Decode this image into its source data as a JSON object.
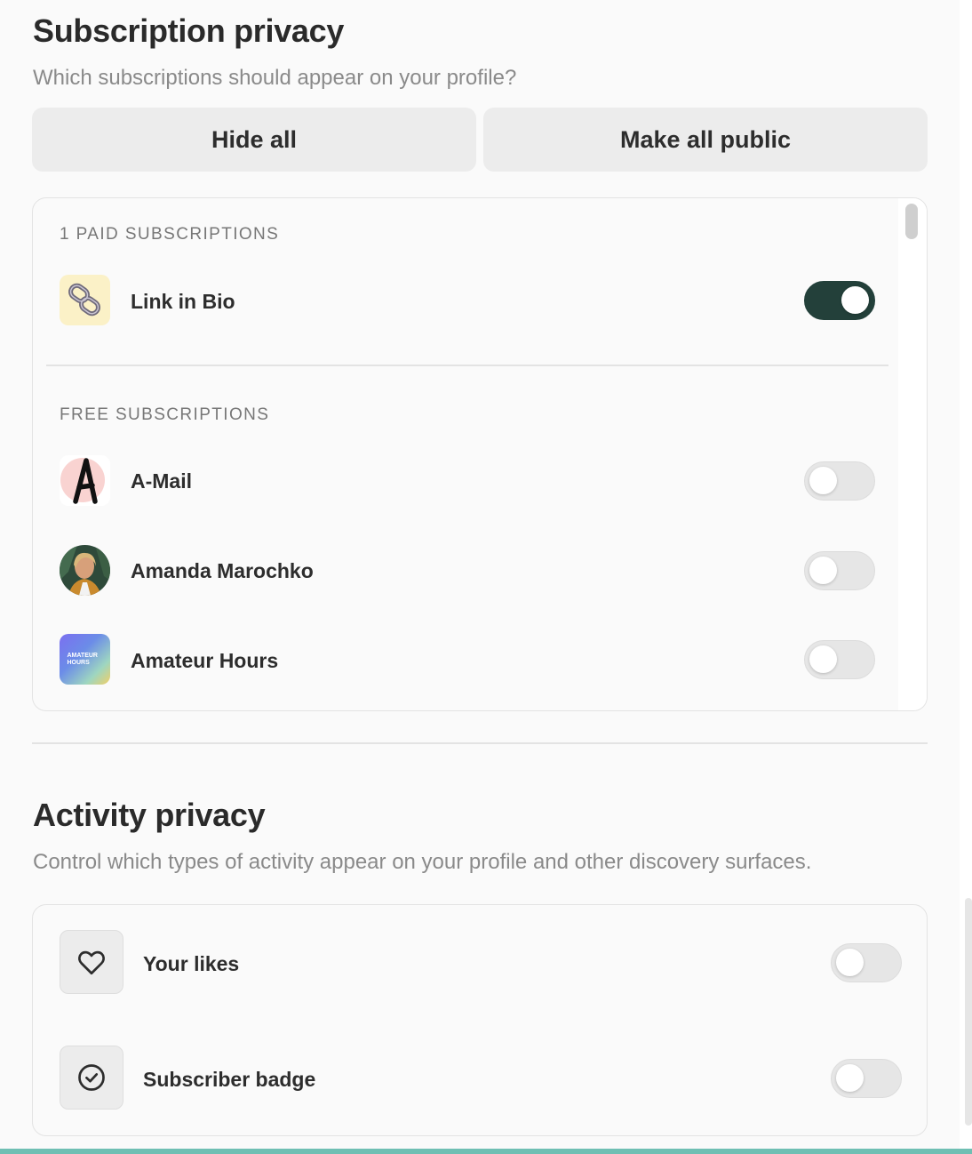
{
  "subscription_privacy": {
    "title": "Subscription privacy",
    "subtitle": "Which subscriptions should appear on your profile?",
    "hide_all_label": "Hide all",
    "make_all_public_label": "Make all public",
    "paid_label": "1 PAID SUBSCRIPTIONS",
    "paid": [
      {
        "name": "Link in Bio",
        "icon": "chain-link-icon",
        "public": true
      }
    ],
    "free_label": "FREE SUBSCRIPTIONS",
    "free": [
      {
        "name": "A-Mail",
        "icon": "letter-a-logo",
        "public": false
      },
      {
        "name": "Amanda Marochko",
        "icon": "person-avatar",
        "public": false
      },
      {
        "name": "Amateur Hours",
        "icon": "amateur-hours-logo",
        "logo_text": "AMATEUR HOURS",
        "public": false
      }
    ]
  },
  "activity_privacy": {
    "title": "Activity privacy",
    "subtitle": "Control which types of activity appear on your profile and other discovery surfaces.",
    "items": [
      {
        "name": "Your likes",
        "icon": "heart-icon",
        "enabled": false
      },
      {
        "name": "Subscriber badge",
        "icon": "check-circle-icon",
        "enabled": false
      }
    ]
  },
  "colors": {
    "toggle_on": "#23403a",
    "toggle_off": "#e6e6e6",
    "bottom_accent": "#6fbfb3"
  }
}
